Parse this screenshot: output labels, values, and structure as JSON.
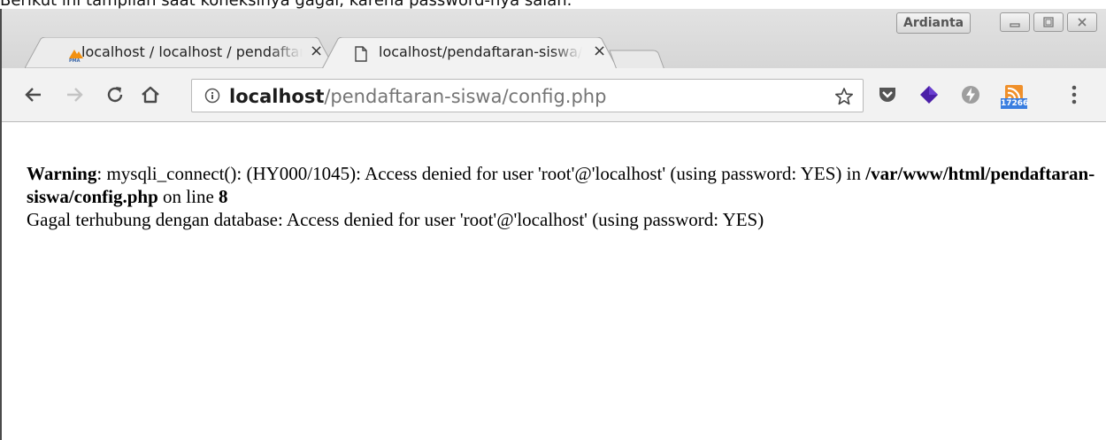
{
  "caption": "Berikut ini tampilan saat koneksinya gagal, karena password-nya salah.",
  "window": {
    "profile_name": "Ardianta",
    "tabs": [
      {
        "title": "localhost / localhost / pendaftaran-siswa | phpMyAdmin",
        "favicon": "phpmyadmin-icon",
        "active": false
      },
      {
        "title": "localhost/pendaftaran-siswa/config.php",
        "favicon": "page-icon",
        "active": true
      }
    ],
    "tab_close_glyph": "×"
  },
  "toolbar": {
    "url_host": "localhost",
    "url_path": "/pendaftaran-siswa/config.php",
    "extensions": [
      {
        "name": "pocket-icon",
        "color": "#555555"
      },
      {
        "name": "gem-icon",
        "color": "#4b1fa8"
      },
      {
        "name": "bolt-icon",
        "color": "#9e9e9e"
      },
      {
        "name": "rss-icon",
        "color": "#f0902a",
        "badge": "17266"
      }
    ]
  },
  "page": {
    "warning_label": "Warning",
    "warning_text_1": ": mysqli_connect(): (HY000/1045): Access denied for user 'root'@'localhost' (using password: YES) in ",
    "warning_file": "/var/www/html/pendaftaran-siswa/config.php",
    "warning_text_2": " on line ",
    "warning_line": "8",
    "error_message": "Gagal terhubung dengan database: Access denied for user 'root'@'localhost' (using password: YES)"
  }
}
